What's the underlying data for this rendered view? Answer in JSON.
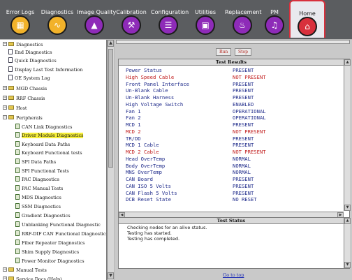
{
  "tabs": [
    {
      "label": "Error Logs",
      "icon": "error-logs-icon",
      "color": "#f2b22a"
    },
    {
      "label": "Diagnostics",
      "icon": "diagnostics-stethoscope-icon",
      "color": "#f2b22a"
    },
    {
      "label": "Image Quality",
      "icon": "image-quality-icon",
      "color": "#8e2bb8"
    },
    {
      "label": "Calibration",
      "icon": "calibration-icon",
      "color": "#8e2bb8"
    },
    {
      "label": "Configuration",
      "icon": "configuration-icon",
      "color": "#8e2bb8"
    },
    {
      "label": "Utilities",
      "icon": "utilities-icon",
      "color": "#8e2bb8"
    },
    {
      "label": "Replacement",
      "icon": "replacement-icon",
      "color": "#8e2bb8"
    },
    {
      "label": "PM",
      "icon": "pm-icon",
      "color": "#8e2bb8"
    },
    {
      "label": "Home",
      "icon": "home-icon",
      "color": "#d8303c"
    }
  ],
  "tree": [
    {
      "label": "Diagnostics",
      "type": "folder",
      "expander": "−"
    },
    {
      "label": "End Diagnostics",
      "type": "doc"
    },
    {
      "label": "Quick Diagnostics",
      "type": "doc"
    },
    {
      "label": "Display Last Test Information",
      "type": "doc"
    },
    {
      "label": "OE System Log",
      "type": "doc"
    },
    {
      "label": "MGD Chassis",
      "type": "folder",
      "expander": "+"
    },
    {
      "label": "RRF Chassis",
      "type": "folder",
      "expander": "+"
    },
    {
      "label": "Host",
      "type": "folder",
      "expander": "+"
    },
    {
      "label": "Peripherals",
      "type": "folder",
      "expander": "−"
    },
    {
      "label": "CAN Link Diagnostics",
      "type": "green"
    },
    {
      "label": "Driver Module Diagnostics",
      "type": "green",
      "selected": true
    },
    {
      "label": "Keyboard Data Paths",
      "type": "green"
    },
    {
      "label": "Keyboard Functional tests",
      "type": "green"
    },
    {
      "label": "SPI Data Paths",
      "type": "green"
    },
    {
      "label": "SPI Functional Tests",
      "type": "green"
    },
    {
      "label": "PAC Diagnostics",
      "type": "green"
    },
    {
      "label": "PAC Manual Tests",
      "type": "green"
    },
    {
      "label": "MDS Diagnostics",
      "type": "green"
    },
    {
      "label": "SSM Diagnostics",
      "type": "green"
    },
    {
      "label": "Gradient Diagnostics",
      "type": "green"
    },
    {
      "label": "Unblanking Functional Diagnostic",
      "type": "green"
    },
    {
      "label": "RRF-DIF CAN Functional Diagnostics",
      "type": "green"
    },
    {
      "label": "Fiber Repeater Diagnostics",
      "type": "green"
    },
    {
      "label": "Shim Supply Diagnostics",
      "type": "green"
    },
    {
      "label": "Power Monitor Diagnostics",
      "type": "green"
    },
    {
      "label": "Manual Tests",
      "type": "folder",
      "expander": "+"
    },
    {
      "label": "Service Docs (Help)",
      "type": "folder",
      "expander": "+"
    }
  ],
  "buttons": {
    "run": "Run",
    "stop": "Stop"
  },
  "results": {
    "title": "Test Results",
    "rows": [
      {
        "name": "Power Status",
        "value": "PRESENT",
        "status": "ok"
      },
      {
        "name": "High Speed Cable",
        "value": "NOT PRESENT",
        "status": "bad"
      },
      {
        "name": "Front Panel Interface",
        "value": "PRESENT",
        "status": "ok"
      },
      {
        "name": "Un-Blank Cable",
        "value": "PRESENT",
        "status": "ok"
      },
      {
        "name": "Un-Blank Harness",
        "value": "PRESENT",
        "status": "ok"
      },
      {
        "name": "High Voltage Switch",
        "value": "ENABLED",
        "status": "ok"
      },
      {
        "name": "Fan 1",
        "value": "OPERATIONAL",
        "status": "ok"
      },
      {
        "name": "Fan 2",
        "value": "OPERATIONAL",
        "status": "ok"
      },
      {
        "name": "MCD 1",
        "value": "PRESENT",
        "status": "ok"
      },
      {
        "name": "MCD 2",
        "value": "NOT PRESENT",
        "status": "bad"
      },
      {
        "name": "TR/DD",
        "value": "PRESENT",
        "status": "ok"
      },
      {
        "name": "MCD 1 Cable",
        "value": "PRESENT",
        "status": "ok"
      },
      {
        "name": "MCD 2 Cable",
        "value": "NOT PRESENT",
        "status": "bad"
      },
      {
        "name": "Head OverTemp",
        "value": "NORMAL",
        "status": "ok"
      },
      {
        "name": "Body OverTemp",
        "value": "NORMAL",
        "status": "ok"
      },
      {
        "name": "MNS OverTemp",
        "value": "NORMAL",
        "status": "ok"
      },
      {
        "name": "CAN Board",
        "value": "PRESENT",
        "status": "ok"
      },
      {
        "name": "CAN ISO 5 Volts",
        "value": "PRESENT",
        "status": "ok"
      },
      {
        "name": "CAN Flash 5 Volts",
        "value": "PRESENT",
        "status": "ok"
      },
      {
        "name": "DCB Reset State",
        "value": "NO RESET",
        "status": "ok"
      }
    ]
  },
  "test_status": {
    "title": "Test Status",
    "lines": [
      "Checking nodes for an alive status.",
      "Testing has started.",
      "Testing has completed."
    ]
  },
  "goto_top": "Go to top",
  "colors": {
    "ok": "#1e2a8a",
    "bad": "#c11d1d",
    "highlight": "#f6ef3a"
  }
}
